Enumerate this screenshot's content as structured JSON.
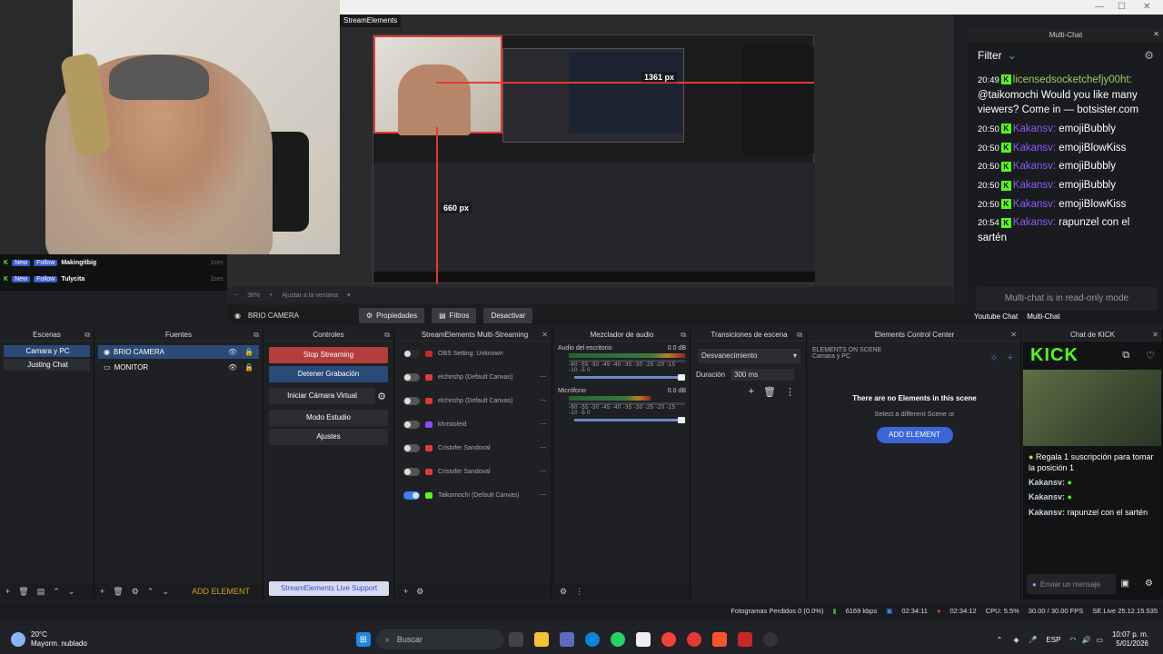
{
  "preview": {
    "title": "StreamElements",
    "measure_w": "1361 px",
    "measure_h": "660 px",
    "zoom": "38%",
    "zoom_mode": "Ajustar a la ventana"
  },
  "alerts": [
    {
      "badge": "New",
      "action": "Follow",
      "name": "Makingitbig",
      "time": "1sec"
    },
    {
      "badge": "New",
      "action": "Follow",
      "name": "Tulycita",
      "time": "1sec"
    }
  ],
  "source_toolbar": {
    "source": "BRIO CAMERA",
    "properties": "Propiedades",
    "filters": "Filtros",
    "deactivate": "Desactivar"
  },
  "multichat": {
    "title": "Multi-Chat",
    "filter": "Filter",
    "messages": [
      {
        "time": "20:49",
        "user": "licensedsocketchefjy00ht:",
        "text": "@taikomochi Would you like many viewers? Come in — botsister.com"
      },
      {
        "time": "20:50",
        "user": "Kakansv:",
        "text": "emojiBubbly"
      },
      {
        "time": "20:50",
        "user": "Kakansv:",
        "text": "emojiBlowKiss"
      },
      {
        "time": "20:50",
        "user": "Kakansv:",
        "text": "emojiBubbly"
      },
      {
        "time": "20:50",
        "user": "Kakansv:",
        "text": "emojiBubbly"
      },
      {
        "time": "20:50",
        "user": "Kakansv:",
        "text": "emojiBlowKiss"
      },
      {
        "time": "20:54",
        "user": "Kakansv:",
        "text": "rapunzel con el sartén"
      }
    ],
    "readonly": "Multi-chat is in read-only mode",
    "tab1": "Youtube Chat",
    "tab2": "Multi-Chat"
  },
  "docks": {
    "scenes": {
      "title": "Escenas",
      "items": [
        "Camara y PC",
        "Justing Chat"
      ]
    },
    "sources": {
      "title": "Fuentes",
      "items": [
        "BRIO CAMERA",
        "MONITOR"
      ],
      "add": "ADD ELEMENT"
    },
    "controls": {
      "title": "Controles",
      "stop": "Stop Streaming",
      "record": "Detener Grabación",
      "vcam": "Iniciar Cámara Virtual",
      "studio": "Modo Estudio",
      "settings": "Ajustes",
      "support": "StreamElements Live Support"
    },
    "multistream": {
      "title": "StreamElements Multi-Streaming",
      "rows": [
        {
          "name": "OBS Setting: Unknown",
          "on": false
        },
        {
          "name": "elchrishp (Default Canvas)",
          "on": false
        },
        {
          "name": "elchrishp (Default Canvas)",
          "on": false
        },
        {
          "name": "khristoleid",
          "on": false
        },
        {
          "name": "Cristofer Sandoval",
          "on": false
        },
        {
          "name": "Cristofer Sandoval",
          "on": false
        },
        {
          "name": "Taikomochi (Default Canvas)",
          "on": true
        }
      ]
    },
    "mixer": {
      "title": "Mezclador de audio",
      "ch1": "Audio del escritorio",
      "ch1db": "0.0 dB",
      "ch2": "Micrófono",
      "ch2db": "0.0 dB",
      "scale": "-60 -55 -50 -45 -40 -35 -30 -25 -20 -15 -10 -5 0"
    },
    "transitions": {
      "title": "Transiciones de escena",
      "type": "Desvanecimiento",
      "duration_label": "Duración",
      "duration": "300 ms"
    },
    "elements": {
      "title": "Elements Control Center",
      "header": "ELEMENTS ON SCENE",
      "scene": "Camara y PC",
      "empty": "There are no Elements in this scene",
      "hint": "Select a different Scene or",
      "button": "ADD ELEMENT"
    },
    "kick": {
      "title": "Chat de KICK",
      "logo": "KICK",
      "gift": "Regala 1 suscripción para tomar la posición 1",
      "msgs": [
        {
          "user": "Kakansv:",
          "text": ""
        },
        {
          "user": "Kakansv:",
          "text": ""
        },
        {
          "user": "Kakansv:",
          "text": "rapunzel con el sartén"
        }
      ],
      "placeholder": "Enviar un mensaje"
    }
  },
  "statusbar": {
    "frames": "Fotogramas Perdidos 0 (0.0%)",
    "kbps": "6169 kbps",
    "rec_time": "02:34:11",
    "live_time": "02:34:12",
    "cpu": "CPU: 5.5%",
    "fps": "30.00 / 30.00 FPS",
    "version": "SE.Live 25.12.15.535"
  },
  "taskbar": {
    "temp": "20°C",
    "weather": "Mayorm. nublado",
    "search": "Buscar",
    "lang": "ESP",
    "time": "10:07 p. m.",
    "date": "5/01/2026"
  }
}
